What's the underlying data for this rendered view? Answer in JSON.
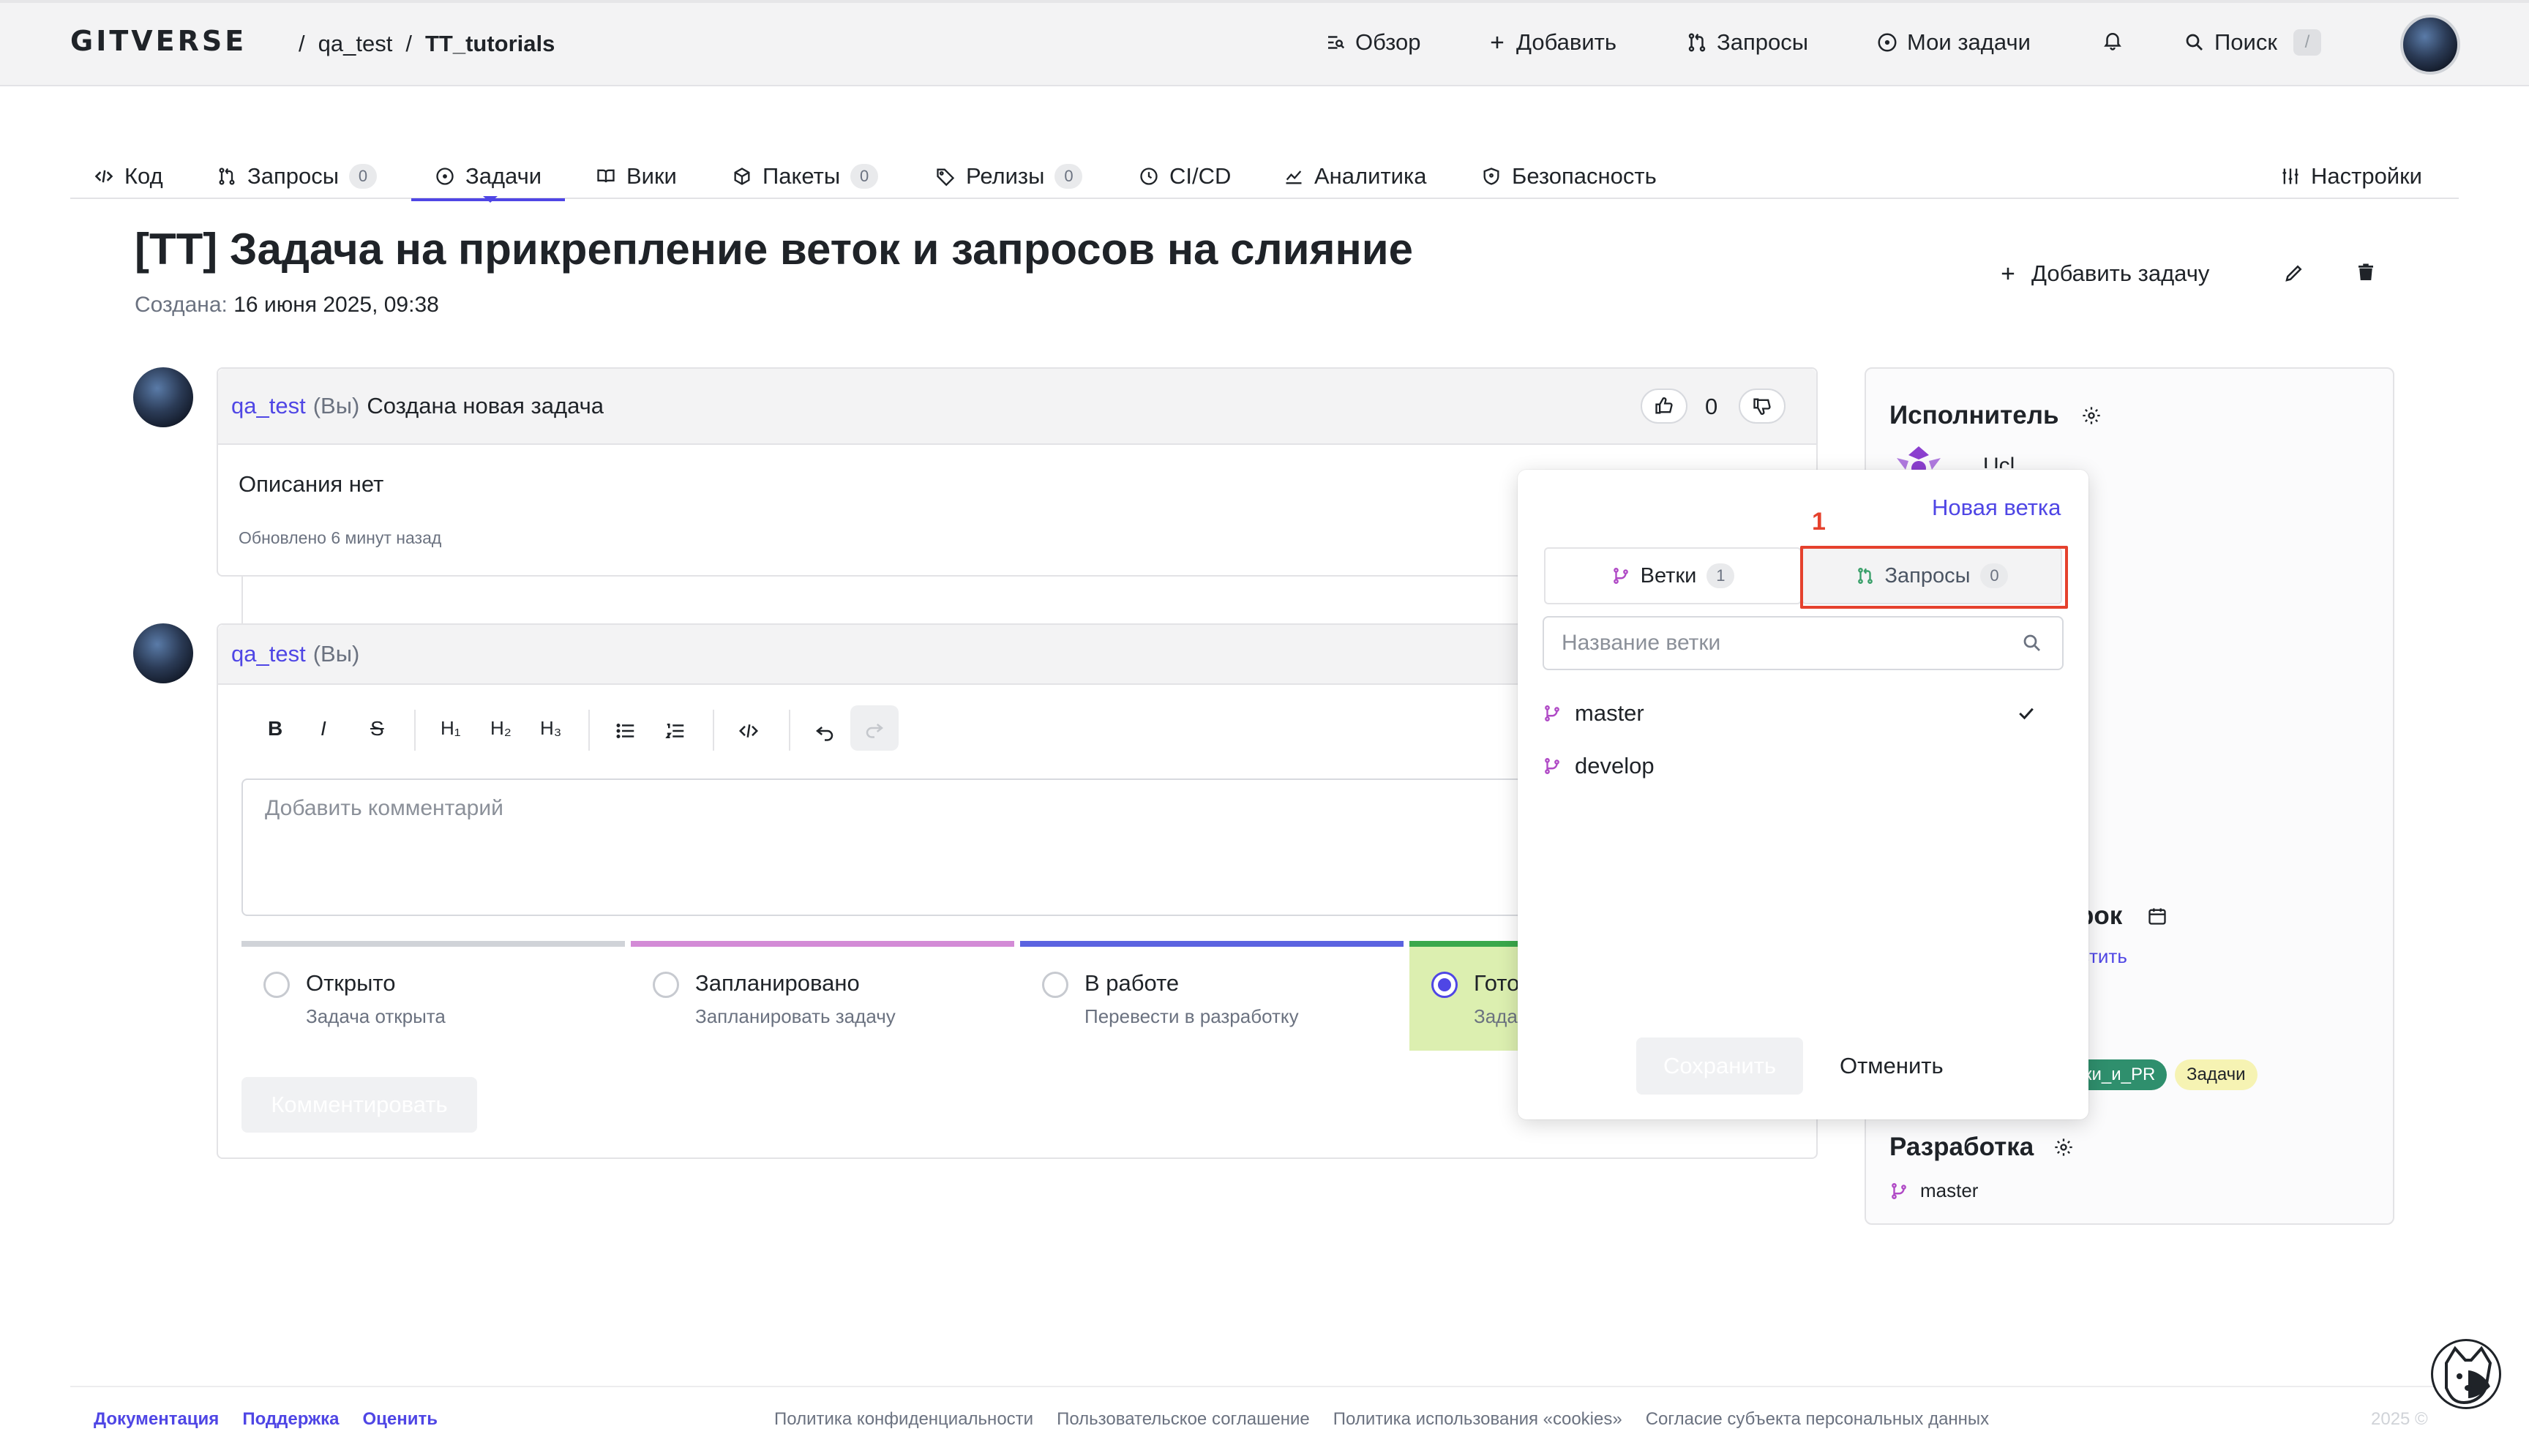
{
  "header": {
    "logo": "GITVERSE",
    "breadcrumb": {
      "owner": "qa_test",
      "repo": "TT_tutorials"
    },
    "nav": {
      "overview": "Обзор",
      "add": "Добавить",
      "requests": "Запросы",
      "my_tasks": "Мои задачи",
      "search": "Поиск",
      "search_shortcut": "/"
    }
  },
  "tabs": [
    {
      "label": "Код"
    },
    {
      "label": "Запросы",
      "count": "0"
    },
    {
      "label": "Задачи"
    },
    {
      "label": "Вики"
    },
    {
      "label": "Пакеты",
      "count": "0"
    },
    {
      "label": "Релизы",
      "count": "0"
    },
    {
      "label": "CI/CD"
    },
    {
      "label": "Аналитика"
    },
    {
      "label": "Безопасность"
    },
    {
      "label": "Настройки"
    }
  ],
  "issue": {
    "title": "[TT] Задача на прикрепление веток и запросов на слияние",
    "created_label": "Создана:",
    "created_value": "16 июня 2025, 09:38",
    "add_task": "Добавить задачу"
  },
  "first_comment": {
    "author": "qa_test",
    "you": "(Вы)",
    "action": "Создана новая задача",
    "reaction_count": "0",
    "body": "Описания нет",
    "updated": "Обновлено 6 минут назад"
  },
  "editor": {
    "author": "qa_test",
    "you": "(Вы)",
    "toolbar": {
      "bold": "B",
      "italic": "I",
      "strike": "S",
      "h1": "H₁",
      "h2": "H₂",
      "h3": "H₃"
    },
    "placeholder": "Добавить комментарий",
    "submit": "Комментировать"
  },
  "statuses": [
    {
      "label": "Открыто",
      "desc": "Задача открыта",
      "color": "#d0d3d8"
    },
    {
      "label": "Запланировано",
      "desc": "Запланировать задачу",
      "color": "#d38bd6"
    },
    {
      "label": "В работе",
      "desc": "Перевести в разработку",
      "color": "#5b63e0"
    },
    {
      "label": "Гото",
      "desc": "Зада",
      "color": "#3aa84b"
    }
  ],
  "sidebar": {
    "assignee": "Исполнитель",
    "assignee_peek": "Ucl",
    "deadline_frag": "рок",
    "deadline_link_frag": "стить",
    "labels": [
      {
        "text": "ки_и_PR"
      },
      {
        "text": "Задачи"
      }
    ],
    "development": "Разработка",
    "dev_branch": "master"
  },
  "popover": {
    "new_branch": "Новая ветка",
    "tab_branches": "Ветки",
    "tab_branches_count": "1",
    "tab_requests": "Запросы",
    "tab_requests_count": "0",
    "search_placeholder": "Название ветки",
    "branches": [
      {
        "name": "master",
        "selected": true
      },
      {
        "name": "develop",
        "selected": false
      }
    ],
    "save": "Сохранить",
    "cancel": "Отменить"
  },
  "annotation": {
    "step": "1"
  },
  "footer": {
    "left": [
      "Документация",
      "Поддержка",
      "Оценить"
    ],
    "center": [
      "Политика конфиденциальности",
      "Пользовательское соглашение",
      "Политика использования «cookies»",
      "Согласие субъекта персональных данных"
    ],
    "copyright": "2025 ©"
  },
  "colors": {
    "accent": "#4f46e5",
    "branch_icon": "#b04ac6",
    "pr_icon": "#3aa06a",
    "highlight": "#e5412d"
  }
}
